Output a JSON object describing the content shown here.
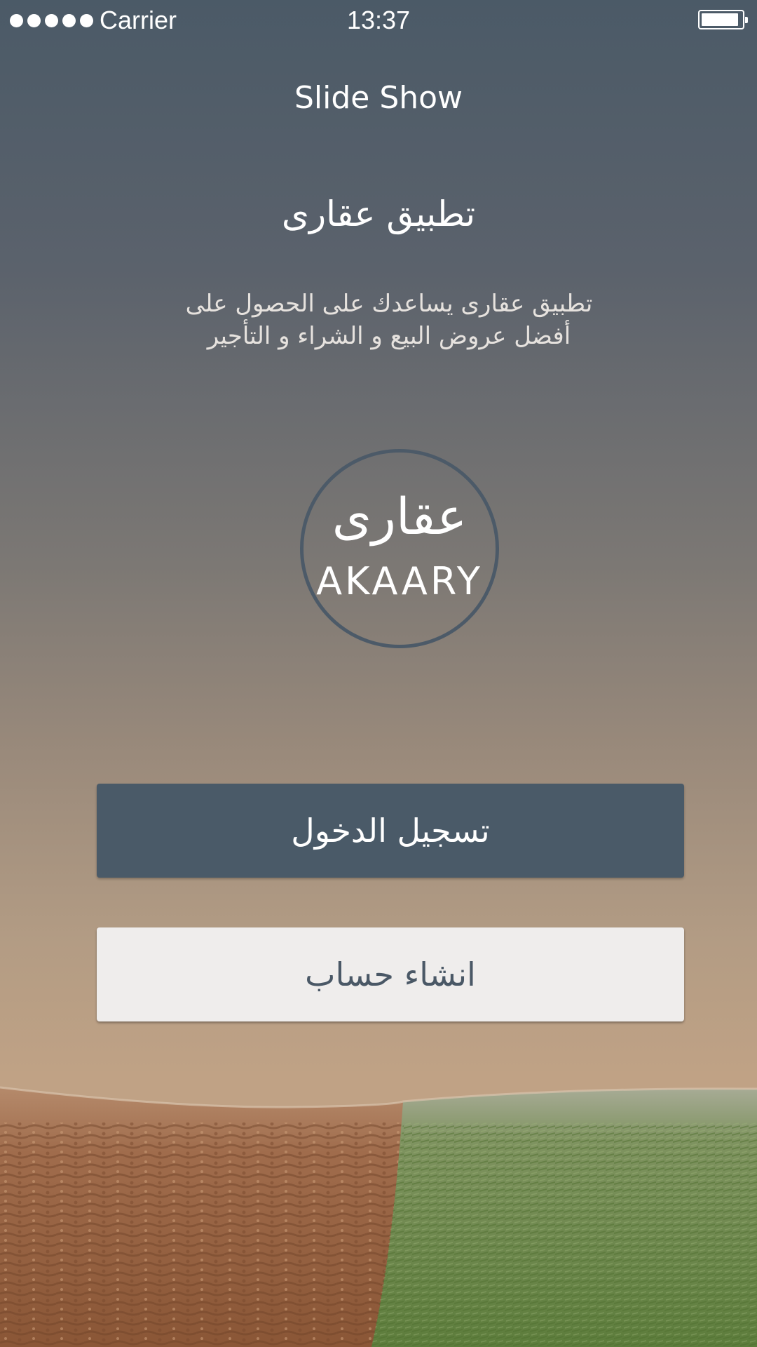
{
  "status_bar": {
    "carrier": "Carrier",
    "time": "13:37",
    "signal_icon": "signal-dots-icon",
    "battery_icon": "battery-full-icon"
  },
  "nav": {
    "title": "Slide Show"
  },
  "intro": {
    "app_title": "تطبيق عقارى",
    "tagline_line1": "تطبيق عقارى يساعدك على الحصول على",
    "tagline_line2": "أفضل عروض البيع و الشراء و التأجير"
  },
  "logo": {
    "arabic": "عقارى",
    "english": "AKAARY"
  },
  "actions": {
    "login_label": "تسجيل الدخول",
    "signup_label": "انشاء حساب"
  },
  "colors": {
    "primary": "#4a5a68",
    "secondary_button": "#efedec",
    "background_top": "#4b5a67",
    "background_bottom": "#c2a385"
  }
}
